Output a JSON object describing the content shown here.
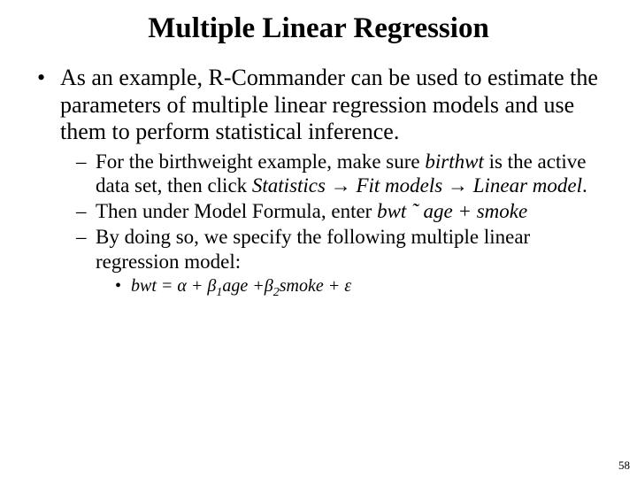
{
  "title": "Multiple Linear Regression",
  "bullet1_text": "As an example, R-Commander can be used to estimate the parameters of multiple linear regression models and use them to perform statistical inference.",
  "sub1_a": "For the birthweight example, make sure ",
  "sub1_b": "birthwt",
  "sub1_c": " is the active data set, then click ",
  "sub1_d": "Statistics",
  "sub1_e": " ",
  "sub1_arrow1": "→",
  "sub1_f": " ",
  "sub1_g": "Fit models",
  "sub1_h": " ",
  "sub1_arrow2": "→",
  "sub1_i": " ",
  "sub1_j": "Linear model",
  "sub1_k": ".",
  "sub2_a": "Then under Model Formula, enter ",
  "sub2_b": "bwt ˜ age + smoke",
  "sub3": "By doing so, we specify the following multiple linear regression model:",
  "eq_a": "bwt = ",
  "eq_alpha": "α",
  "eq_b": " + ",
  "eq_beta1": "β",
  "eq_sub1": "1",
  "eq_c": "age +",
  "eq_beta2": "β",
  "eq_sub2": "2",
  "eq_d": "smoke + ",
  "eq_eps": "ε",
  "page": "58"
}
